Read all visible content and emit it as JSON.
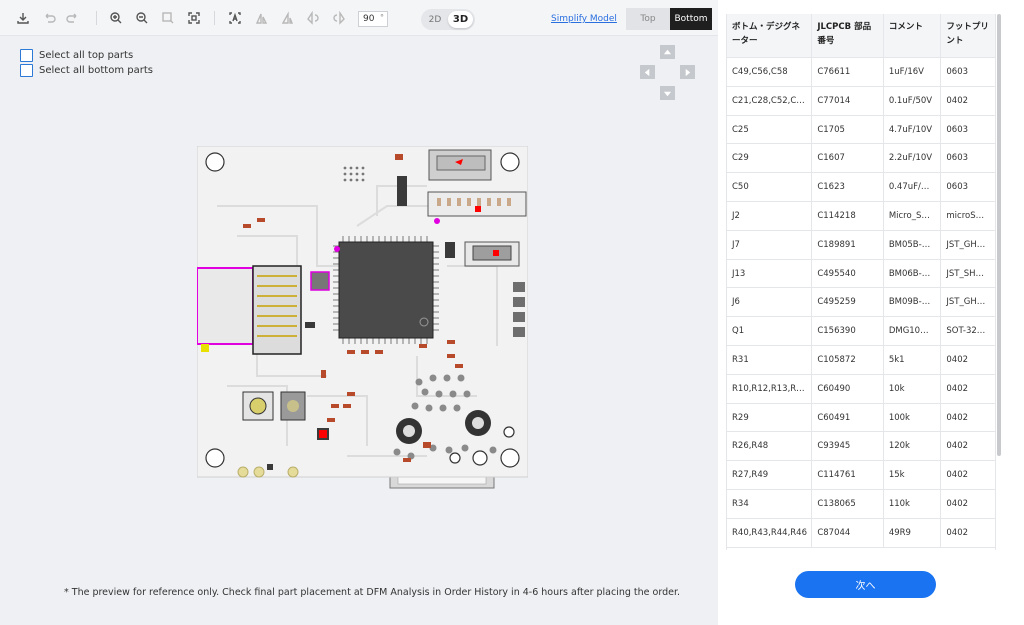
{
  "toolbar": {
    "angle_value": "90",
    "angle_unit": "°",
    "mode_2d": "2D",
    "mode_3d": "3D",
    "simplify_label": "Simplify Model",
    "side_top": "Top",
    "side_bottom": "Bottom",
    "icons": [
      "download-icon",
      "undo-icon",
      "redo-icon",
      "zoom-in-icon",
      "zoom-out-icon",
      "zoom-area-icon",
      "fit-view-icon",
      "text-select-icon",
      "rotate-icon",
      "rotate-icon",
      "rotate-icon",
      "rotate-icon"
    ]
  },
  "selection": {
    "top_label": "Select all top parts",
    "bottom_label": "Select all bottom parts"
  },
  "footnote": "* The preview for reference only. Check final part placement at DFM Analysis in Order History in 4-6 hours after placing the order.",
  "bom": {
    "headers": [
      "ボトム・デジグネーター",
      "JLCPCB 部品番号",
      "コメント",
      "フットプリント"
    ],
    "rows": [
      [
        "C49,C56,C58",
        "C76611",
        "1uF/16V",
        "0603"
      ],
      [
        "C21,C28,C52,C…",
        "C77014",
        "0.1uF/50V",
        "0402"
      ],
      [
        "C25",
        "C1705",
        "4.7uF/10V",
        "0603"
      ],
      [
        "C29",
        "C1607",
        "2.2uF/10V",
        "0603"
      ],
      [
        "C50",
        "C1623",
        "0.47uF/…",
        "0603"
      ],
      [
        "J2",
        "C114218",
        "Micro_S…",
        "microS…"
      ],
      [
        "J7",
        "C189891",
        "BM05B-…",
        "JST_GH…"
      ],
      [
        "J13",
        "C495540",
        "BM06B-…",
        "JST_SH…"
      ],
      [
        "J6",
        "C495259",
        "BM09B-…",
        "JST_GH…"
      ],
      [
        "Q1",
        "C156390",
        "DMG10…",
        "SOT-32…"
      ],
      [
        "R31",
        "C105872",
        "5k1",
        "0402"
      ],
      [
        "R10,R12,R13,R…",
        "C60490",
        "10k",
        "0402"
      ],
      [
        "R29",
        "C60491",
        "100k",
        "0402"
      ],
      [
        "R26,R48",
        "C93945",
        "120k",
        "0402"
      ],
      [
        "R27,R49",
        "C114761",
        "15k",
        "0402"
      ],
      [
        "R34",
        "C138065",
        "110k",
        "0402"
      ],
      [
        "R40,R43,R44,R46",
        "C87044",
        "49R9",
        "0402"
      ]
    ]
  },
  "next_label": "次へ",
  "colors": {
    "accent": "#1a73f0",
    "pcb_board": "#f2f2f2",
    "ic_body": "#4a4a4a",
    "highlight": "#e000e0",
    "marker": "#ff0000"
  }
}
